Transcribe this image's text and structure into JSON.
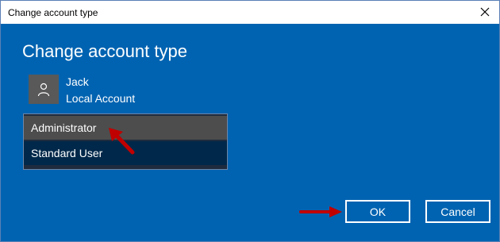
{
  "window": {
    "title": "Change account type"
  },
  "dialog": {
    "heading": "Change account type",
    "user": {
      "name": "Jack",
      "account_type": "Local Account"
    },
    "account_options": [
      {
        "label": "Administrator",
        "highlighted": true
      },
      {
        "label": "Standard User",
        "highlighted": false
      }
    ]
  },
  "buttons": {
    "ok": "OK",
    "cancel": "Cancel"
  },
  "colors": {
    "dialog_bg": "#0063b1",
    "arrow": "#c00000",
    "dropdown_bg": "#1e2b3e"
  },
  "icons": {
    "avatar": "user-icon",
    "close": "close-icon",
    "annotations": "red-pointer-arrow"
  }
}
